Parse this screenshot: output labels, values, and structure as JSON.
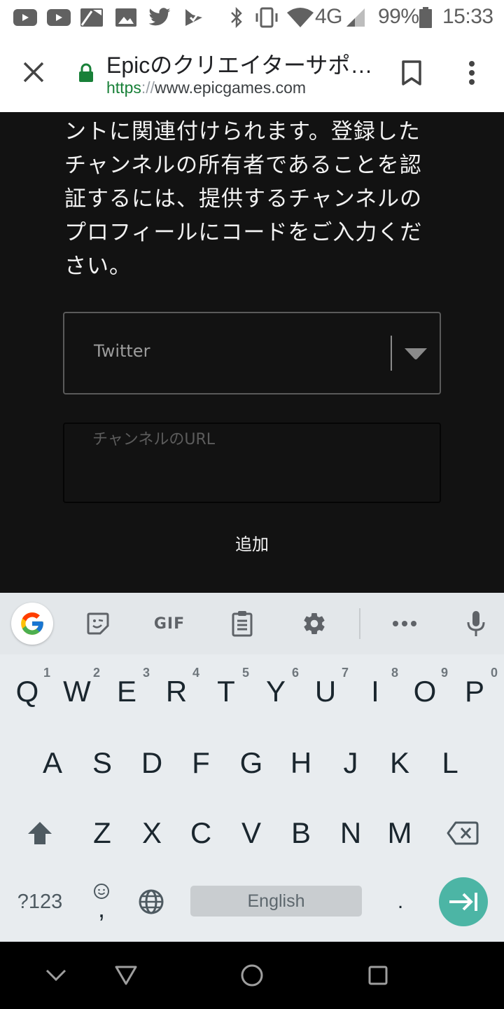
{
  "status_bar": {
    "notification_icons": [
      "youtube-icon",
      "youtube-icon",
      "photo-sticky-icon",
      "gallery-icon",
      "twitter-icon",
      "inbox-check-icon"
    ],
    "system_icons": [
      "bluetooth-icon",
      "vibrate-icon",
      "wifi-icon"
    ],
    "network": "4G",
    "battery": "99%",
    "time": "15:33"
  },
  "browser": {
    "page_title": "Epicのクリエイターサポ…",
    "url_scheme": "https",
    "url_separator": "://",
    "url_host": "www.epicgames.com",
    "close_icon": "close-icon",
    "lock_icon": "lock-icon",
    "bookmark_icon": "bookmark-icon",
    "menu_icon": "more-vert-icon"
  },
  "page": {
    "paragraph_lines": [
      "ントに関連付けられます。登録した",
      "チャンネルの所有者であることを認",
      "証するには、提供するチャンネルの",
      "プロフィールにコードをご入力くだ",
      "さい。"
    ],
    "platform_select": {
      "value": "Twitter"
    },
    "channel_url": {
      "value": "",
      "placeholder": "チャンネルのURL"
    },
    "add_button": "追加"
  },
  "keyboard": {
    "toolbar": [
      "google-icon",
      "sticker-icon",
      "GIF",
      "clipboard-icon",
      "settings-icon",
      "more-horiz-icon",
      "mic-icon"
    ],
    "gif_label": "GIF",
    "row1": [
      {
        "key": "Q",
        "hint": "1"
      },
      {
        "key": "W",
        "hint": "2"
      },
      {
        "key": "E",
        "hint": "3"
      },
      {
        "key": "R",
        "hint": "4"
      },
      {
        "key": "T",
        "hint": "5"
      },
      {
        "key": "Y",
        "hint": "6"
      },
      {
        "key": "U",
        "hint": "7"
      },
      {
        "key": "I",
        "hint": "8"
      },
      {
        "key": "O",
        "hint": "9"
      },
      {
        "key": "P",
        "hint": "0"
      }
    ],
    "row2": [
      "A",
      "S",
      "D",
      "F",
      "G",
      "H",
      "J",
      "K",
      "L"
    ],
    "row3": [
      "Z",
      "X",
      "C",
      "V",
      "B",
      "N",
      "M"
    ],
    "symbols_key": "?123",
    "comma_key": ",",
    "space_label": "English",
    "period_key": ".",
    "accent_color": "#4cb5a5"
  },
  "nav_bar": [
    "hide-keyboard-icon",
    "back-icon",
    "home-icon",
    "recents-icon"
  ]
}
